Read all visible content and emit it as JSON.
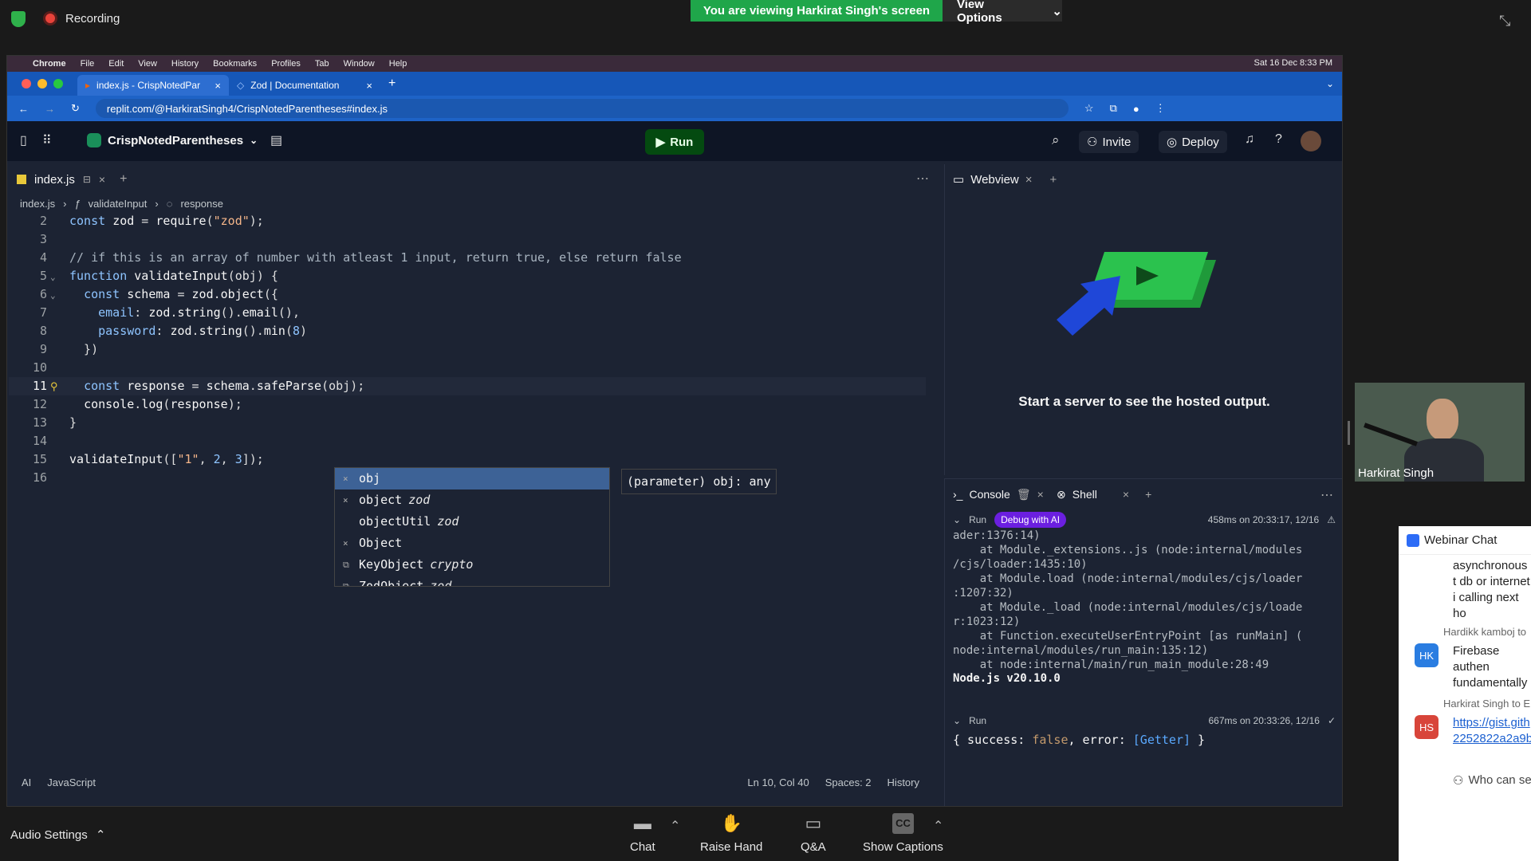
{
  "zoom": {
    "recording_label": "Recording",
    "viewing_banner": "You are viewing Harkirat Singh's screen",
    "view_options_label": "View Options",
    "audio_settings_label": "Audio Settings",
    "controls": [
      {
        "label": "Chat",
        "icon": "chat-icon"
      },
      {
        "label": "Raise Hand",
        "icon": "hand-icon"
      },
      {
        "label": "Q&A",
        "icon": "qa-icon"
      },
      {
        "label": "Show Captions",
        "icon": "cc-icon"
      }
    ],
    "cc_glyph": "CC",
    "participant_name": "Harkirat Singh"
  },
  "mac_menu": {
    "app": "Chrome",
    "items": [
      "File",
      "Edit",
      "View",
      "History",
      "Bookmarks",
      "Profiles",
      "Tab",
      "Window",
      "Help"
    ],
    "clock": "Sat 16 Dec  8:33 PM"
  },
  "browser": {
    "tabs": [
      {
        "title": "index.js - CrispNotedParenth",
        "active": true
      },
      {
        "title": "Zod | Documentation",
        "active": false
      }
    ],
    "url": "replit.com/@HarkiratSingh4/CrispNotedParentheses#index.js"
  },
  "replit": {
    "project_name": "CrispNotedParentheses",
    "run_label": "Run",
    "invite_label": "Invite",
    "deploy_label": "Deploy",
    "help_glyph": "?",
    "editor_tab": "index.js",
    "breadcrumb": {
      "file": "index.js",
      "fn": "validateInput",
      "var": "response"
    },
    "line_numbers": [
      "2",
      "3",
      "4",
      "5",
      "6",
      "7",
      "8",
      "9",
      "10",
      "11",
      "12",
      "13",
      "14",
      "15",
      "16"
    ],
    "code_lines": [
      "const zod = require(\"zod\");",
      "",
      "// if this is an array of number with atleast 1 input, return true, else return false",
      "function validateInput(obj) {",
      "  const schema = zod.object({",
      "    email: zod.string().email(),",
      "    password: zod.string().min(8)",
      "  })",
      "",
      "  const response = schema.safeParse(obj);",
      "  console.log(response);",
      "}",
      "",
      "validateInput([\"1\", 2, 3]);",
      ""
    ],
    "autocomplete": [
      {
        "name": "obj",
        "source": ""
      },
      {
        "name": "object",
        "source": "zod"
      },
      {
        "name": "objectUtil",
        "source": "zod"
      },
      {
        "name": "Object",
        "source": ""
      },
      {
        "name": "KeyObject",
        "source": "crypto"
      },
      {
        "name": "ZodObject",
        "source": "zod"
      }
    ],
    "hint": "(parameter) obj: any",
    "status": {
      "ai": "AI",
      "language": "JavaScript",
      "position": "Ln 10, Col 40",
      "spaces": "Spaces: 2",
      "history": "History"
    },
    "webview": {
      "tab": "Webview",
      "message": "Start a server to see the hosted output."
    },
    "console": {
      "tab_console": "Console",
      "tab_shell": "Shell",
      "run1": {
        "label": "Run",
        "debug": "Debug with AI",
        "time": "458ms on 20:33:17, 12/16"
      },
      "trace": "ader:1376:14)\n    at Module._extensions..js (node:internal/modules\n/cjs/loader:1435:10)\n    at Module.load (node:internal/modules/cjs/loader\n:1207:32)\n    at Module._load (node:internal/modules/cjs/loade\nr:1023:12)\n    at Function.executeUserEntryPoint [as runMain] (\nnode:internal/modules/run_main:135:12)\n    at node:internal/main/run_main_module:28:49",
      "node_version": "Node.js v20.10.0",
      "run2": {
        "label": "Run",
        "time": "667ms on 20:33:26, 12/16"
      },
      "output": {
        "pre": "{ success: ",
        "val": "false",
        "mid": ", error: ",
        "getter": "[Getter]",
        "post": " }"
      }
    }
  },
  "webinar_chat": {
    "title": "Webinar Chat",
    "messages": [
      {
        "sender": "",
        "initials": "",
        "text": "asynchronous t db or internet i calling next ho"
      },
      {
        "sender": "Hardikk kamboj to",
        "initials": "HK",
        "text": "Firebase authen fundamentally"
      },
      {
        "sender": "Harkirat Singh to E",
        "initials": "HS",
        "text": "https://gist.gith 2252822a2a9b"
      }
    ],
    "footer": "Who can se"
  }
}
